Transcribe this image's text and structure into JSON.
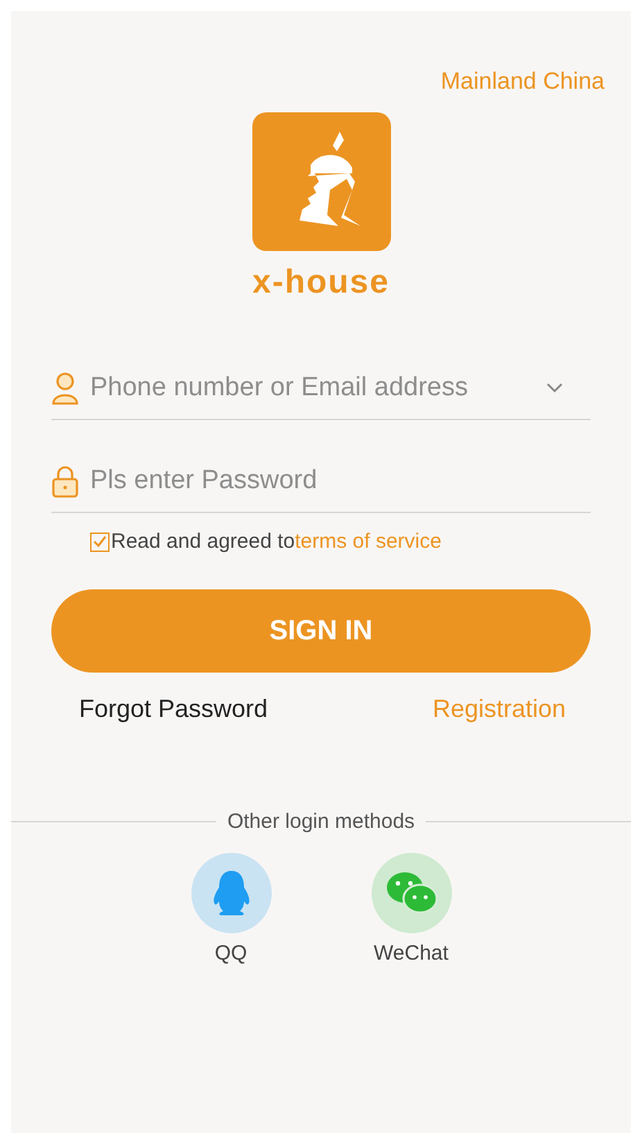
{
  "region": "Mainland China",
  "logo": {
    "wordmark": "x-house"
  },
  "fields": [
    {
      "kind": "account",
      "placeholder": "Phone number or Email address",
      "dropdown": true
    },
    {
      "kind": "password",
      "placeholder": "Pls enter Password",
      "dropdown": false
    }
  ],
  "agreement": {
    "checked": true,
    "text": "Read and agreed to",
    "link": "terms of service"
  },
  "sign_in": "SIGN IN",
  "forgot_password": "Forgot Password",
  "registration": "Registration",
  "other_login": {
    "title": "Other login methods",
    "methods": [
      {
        "kind": "qq",
        "label": "QQ"
      },
      {
        "kind": "wechat",
        "label": "WeChat"
      }
    ]
  }
}
